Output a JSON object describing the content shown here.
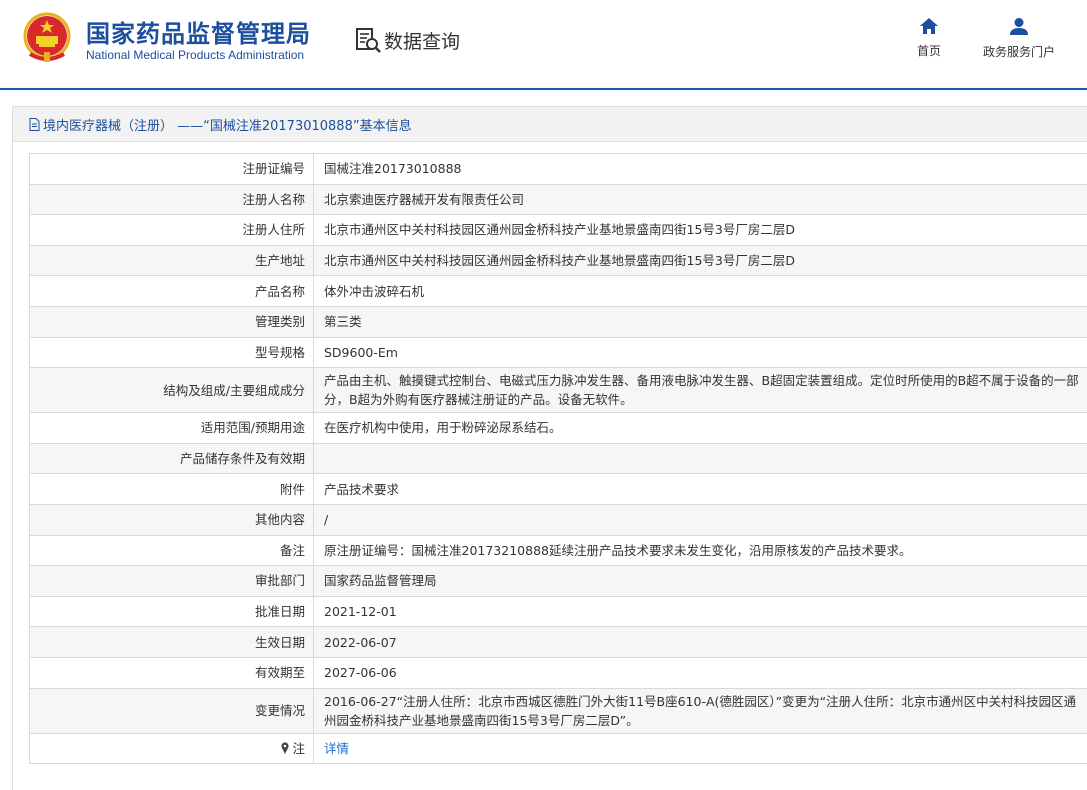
{
  "header": {
    "brand_cn": "国家药品监督管理局",
    "brand_en": "National Medical Products Administration",
    "query_label": "数据查询",
    "nav": [
      {
        "label": "首页",
        "icon": "home-icon"
      },
      {
        "label": "政务服务门户",
        "icon": "user-icon"
      }
    ]
  },
  "breadcrumb": "境内医疗器械（注册） ——“国械注准20173010888”基本信息",
  "colors": {
    "brand": "#1d4f9e",
    "link": "#1d6fd0",
    "row_alt": "#f6f6f6",
    "border": "#d9d9d9"
  },
  "rows": [
    {
      "key": "注册证编号",
      "value": "国械注准20173010888"
    },
    {
      "key": "注册人名称",
      "value": "北京索迪医疗器械开发有限责任公司"
    },
    {
      "key": "注册人住所",
      "value": "北京市通州区中关村科技园区通州园金桥科技产业基地景盛南四街15号3号厂房二层D"
    },
    {
      "key": "生产地址",
      "value": "北京市通州区中关村科技园区通州园金桥科技产业基地景盛南四街15号3号厂房二层D"
    },
    {
      "key": "产品名称",
      "value": "体外冲击波碎石机"
    },
    {
      "key": "管理类别",
      "value": "第三类"
    },
    {
      "key": "型号规格",
      "value": "SD9600-Em"
    },
    {
      "key": "结构及组成/主要组成成分",
      "value": "产品由主机、触摸键式控制台、电磁式压力脉冲发生器、备用液电脉冲发生器、B超固定装置组成。定位时所使用的B超不属于设备的一部分，B超为外购有医疗器械注册证的产品。设备无软件。"
    },
    {
      "key": "适用范围/预期用途",
      "value": "在医疗机构中使用，用于粉碎泌尿系结石。"
    },
    {
      "key": "产品储存条件及有效期",
      "value": ""
    },
    {
      "key": "附件",
      "value": "产品技术要求"
    },
    {
      "key": "其他内容",
      "value": "/"
    },
    {
      "key": "备注",
      "value": "原注册证编号：国械注准20173210888延续注册产品技术要求未发生变化，沿用原核发的产品技术要求。"
    },
    {
      "key": "审批部门",
      "value": "国家药品监督管理局"
    },
    {
      "key": "批准日期",
      "value": "2021-12-01"
    },
    {
      "key": "生效日期",
      "value": "2022-06-07"
    },
    {
      "key": "有效期至",
      "value": "2027-06-06"
    },
    {
      "key": "变更情况",
      "value": "2016-06-27“注册人住所：北京市西城区德胜门外大街11号B座610-A(德胜园区）”变更为“注册人住所：北京市通州区中关村科技园区通州园金桥科技产业基地景盛南四街15号3号厂房二层D”。"
    }
  ],
  "note": {
    "key": "注",
    "link": "详情"
  }
}
